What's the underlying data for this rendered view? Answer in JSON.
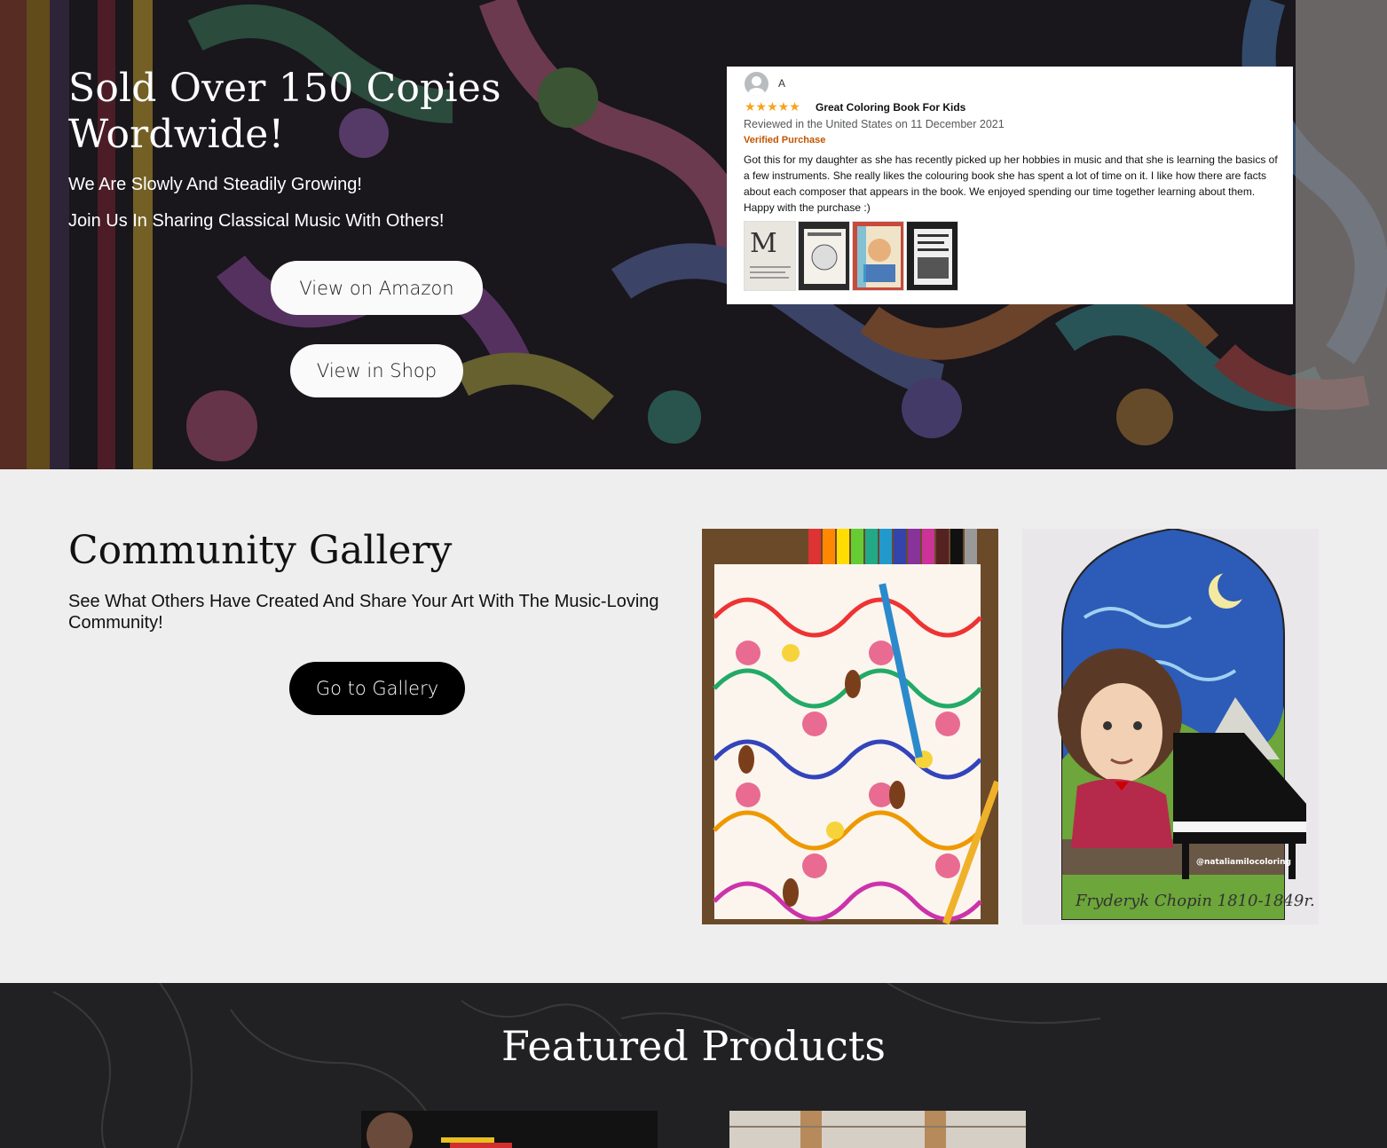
{
  "hero": {
    "title": "Sold Over 150 Copies Wordwide!",
    "subtitle1": "We Are Slowly And Steadily Growing!",
    "subtitle2": "Join Us In Sharing Classical Music With Others!",
    "amazon_button": "View on Amazon",
    "shop_button": "View in Shop"
  },
  "review": {
    "username": "A",
    "stars": "★★★★★",
    "title": "Great Coloring Book For Kids",
    "meta": "Reviewed in the United States on 11 December 2021",
    "verified": "Verified Purchase",
    "body": "Got this for my daughter as she has recently picked up her hobbies in music and that she is learning the basics of a few instruments. She really likes the colouring book she has spent a lot of time on it. I like how there are facts about each composer that appears in the book. We enjoyed spending our time together learning about them. Happy with the purchase :)"
  },
  "gallery": {
    "title": "Community Gallery",
    "description": "See What Others Have Created And Share Your Art With The Music-Loving Community!",
    "button": "Go to Gallery",
    "image2_watermark": "@nataliamilocoloring",
    "image2_caption": "Fryderyk Chopin 1810-1849r."
  },
  "featured": {
    "title": "Featured Products"
  },
  "colors": {
    "button_light": "#fafafa",
    "button_dark": "#000000",
    "section_bg": "#efeeee",
    "verified": "#c45500",
    "stars": "#f4a41c"
  }
}
